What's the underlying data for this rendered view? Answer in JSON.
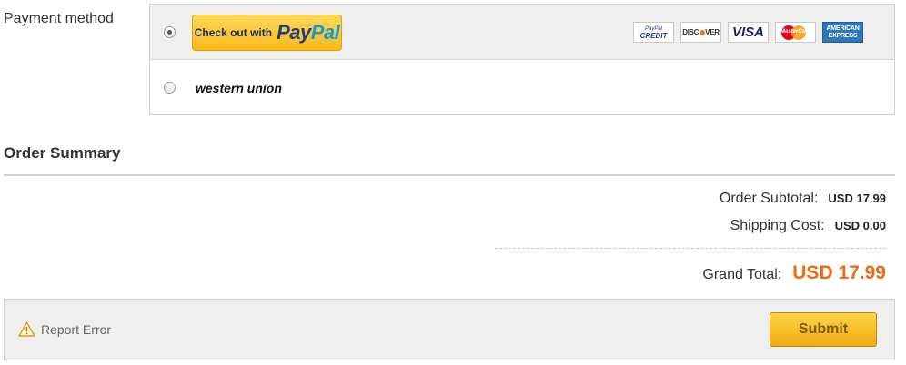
{
  "payment": {
    "label": "Payment method",
    "paypal": {
      "selected": true,
      "button_text": "Check out with",
      "logo_pay": "Pay",
      "logo_pal": "Pal",
      "cards": [
        {
          "icon": "paypal-credit-icon",
          "line1": "PayPal",
          "line2": "CREDIT"
        },
        {
          "icon": "discover-icon",
          "text_a": "DISC",
          "text_b": "VER"
        },
        {
          "icon": "visa-icon",
          "text": "VISA"
        },
        {
          "icon": "mastercard-icon",
          "text": "MasterCard"
        },
        {
          "icon": "amex-icon",
          "line1": "AMERICAN",
          "line2": "EXPRESS"
        }
      ]
    },
    "western_union": {
      "selected": false,
      "label": "western union"
    }
  },
  "summary": {
    "title": "Order Summary",
    "subtotal_label": "Order Subtotal:",
    "subtotal_value": "USD 17.99",
    "shipping_label": "Shipping Cost:",
    "shipping_value": "USD 0.00",
    "grand_label": "Grand Total:",
    "grand_value": "USD 17.99"
  },
  "footer": {
    "report_label": "Report Error",
    "report_icon": "warning-triangle-icon",
    "submit_label": "Submit"
  },
  "colors": {
    "accent_orange": "#f26a10",
    "button_yellow": "#f8b91a",
    "panel_gray": "#efefef"
  }
}
